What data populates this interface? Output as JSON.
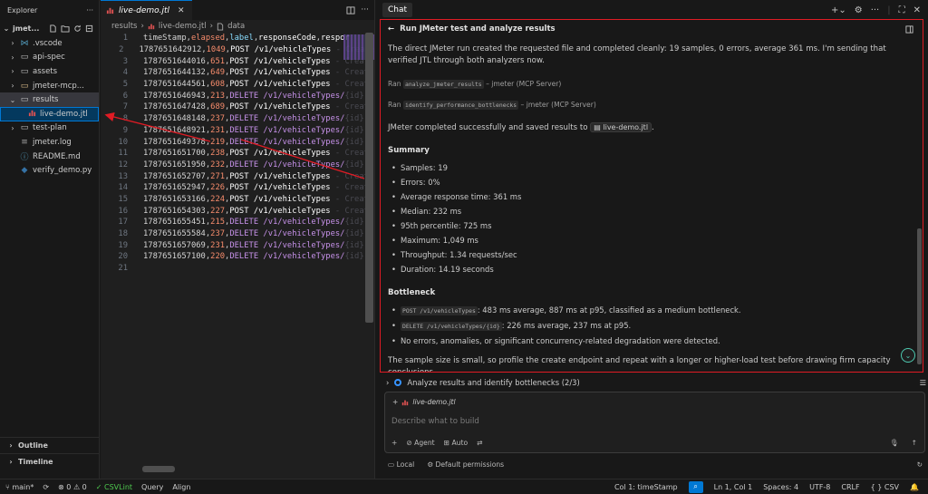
{
  "explorer": {
    "title": "Explorer",
    "project": "jmet...",
    "items": [
      {
        "label": ".vscode",
        "type": "folder",
        "indent": 1,
        "chev": "›",
        "color": "#519aba",
        "icon": "vscode-folder-icon"
      },
      {
        "label": "api-spec",
        "type": "folder",
        "indent": 1,
        "chev": "›",
        "color": "#c5c5c5",
        "icon": "folder-icon"
      },
      {
        "label": "assets",
        "type": "folder",
        "indent": 1,
        "chev": "›",
        "color": "#c5c5c5",
        "icon": "folder-icon"
      },
      {
        "label": "jmeter-mcp...",
        "type": "folder",
        "indent": 1,
        "chev": "›",
        "color": "#e2c08d",
        "icon": "folder-icon"
      },
      {
        "label": "results",
        "type": "folder-open",
        "indent": 1,
        "chev": "⌄",
        "color": "#c5c5c5",
        "icon": "folder-open-icon",
        "state": "selected"
      },
      {
        "label": "live-demo.jtl",
        "type": "file",
        "indent": 2,
        "chev": "",
        "color": "#e05252",
        "icon": "chart-file-icon",
        "state": "active"
      },
      {
        "label": "test-plan",
        "type": "folder",
        "indent": 1,
        "chev": "›",
        "color": "#c5c5c5",
        "icon": "folder-icon"
      },
      {
        "label": "jmeter.log",
        "type": "file",
        "indent": 1,
        "chev": "",
        "color": "#a0a0a0",
        "icon": "log-file-icon"
      },
      {
        "label": "README.md",
        "type": "file",
        "indent": 1,
        "chev": "",
        "color": "#519aba",
        "icon": "markdown-file-icon"
      },
      {
        "label": "verify_demo.py",
        "type": "file",
        "indent": 1,
        "chev": "",
        "color": "#3572a5",
        "icon": "python-file-icon"
      }
    ],
    "outline_label": "Outline",
    "timeline_label": "Timeline"
  },
  "editor": {
    "tab_label": "live-demo.jtl",
    "breadcrumb": [
      "results",
      "live-demo.jtl",
      "data"
    ],
    "header": {
      "c1": "timeStamp",
      "c2": "elapsed",
      "c3": "label",
      "c4": "responseCode",
      "c5": "respor"
    },
    "rows": [
      {
        "ts": "1787651642912",
        "el": "1049",
        "lb": "POST /v1/vehicleTypes",
        "rest": " - Create"
      },
      {
        "ts": "1787651644016",
        "el": "651",
        "lb": "POST /v1/vehicleTypes",
        "rest": " - Create"
      },
      {
        "ts": "1787651644132",
        "el": "649",
        "lb": "POST /v1/vehicleTypes",
        "rest": " - Create"
      },
      {
        "ts": "1787651644561",
        "el": "608",
        "lb": "POST /v1/vehicleTypes",
        "rest": " - Create"
      },
      {
        "ts": "1787651646943",
        "el": "213",
        "lb": "DELETE /v1/vehicleTypes/",
        "rest": "{id}"
      },
      {
        "ts": "1787651647428",
        "el": "689",
        "lb": "POST /v1/vehicleTypes",
        "rest": " - Create"
      },
      {
        "ts": "1787651648148",
        "el": "237",
        "lb": "DELETE /v1/vehicleTypes/",
        "rest": "{id}"
      },
      {
        "ts": "1787651648921",
        "el": "231",
        "lb": "DELETE /v1/vehicleTypes/",
        "rest": "{id}"
      },
      {
        "ts": "1787651649378",
        "el": "219",
        "lb": "DELETE /v1/vehicleTypes/",
        "rest": "{id}"
      },
      {
        "ts": "1787651651700",
        "el": "238",
        "lb": "POST /v1/vehicleTypes",
        "rest": " - Create"
      },
      {
        "ts": "1787651651950",
        "el": "232",
        "lb": "DELETE /v1/vehicleTypes/",
        "rest": "{id}"
      },
      {
        "ts": "1787651652707",
        "el": "271",
        "lb": "POST /v1/vehicleTypes",
        "rest": " - Create"
      },
      {
        "ts": "1787651652947",
        "el": "226",
        "lb": "POST /v1/vehicleTypes",
        "rest": " - Create"
      },
      {
        "ts": "1787651653166",
        "el": "224",
        "lb": "POST /v1/vehicleTypes",
        "rest": " - Create"
      },
      {
        "ts": "1787651654303",
        "el": "227",
        "lb": "POST /v1/vehicleTypes",
        "rest": " - Create"
      },
      {
        "ts": "1787651655451",
        "el": "215",
        "lb": "DELETE /v1/vehicleTypes/",
        "rest": "{id}"
      },
      {
        "ts": "1787651655584",
        "el": "237",
        "lb": "DELETE /v1/vehicleTypes/",
        "rest": "{id}"
      },
      {
        "ts": "1787651657069",
        "el": "231",
        "lb": "DELETE /v1/vehicleTypes/",
        "rest": "{id}"
      },
      {
        "ts": "1787651657100",
        "el": "220",
        "lb": "DELETE /v1/vehicleTypes/",
        "rest": "{id}"
      }
    ],
    "last_line_number": "21"
  },
  "chat": {
    "tab_label": "Chat",
    "response_title": "Run JMeter test and analyze results",
    "intro": "The direct JMeter run created the requested file and completed cleanly: 19 samples, 0 errors, average 361 ms. I'm sending that verified JTL through both analyzers now.",
    "ran1": {
      "prefix": "Ran",
      "tool": "analyze_jmeter_results",
      "suffix": "– jmeter (MCP Server)"
    },
    "ran2": {
      "prefix": "Ran",
      "tool": "identify_performance_bottlenecks",
      "suffix": "– jmeter (MCP Server)"
    },
    "completed": {
      "before": "JMeter completed successfully and saved results to",
      "file": "live-demo.jtl",
      "after": "."
    },
    "summary_heading": "Summary",
    "summary": [
      "Samples: 19",
      "Errors: 0%",
      "Average response time: 361 ms",
      "Median: 232 ms",
      "95th percentile: 725 ms",
      "Maximum: 1,049 ms",
      "Throughput: 1.34 requests/sec",
      "Duration: 14.19 seconds"
    ],
    "bottleneck_heading": "Bottleneck",
    "bottleneck_1": {
      "code": "POST /v1/vehicleTypes",
      "text": ": 483 ms average, 887 ms at p95, classified as a medium bottleneck."
    },
    "bottleneck_2": {
      "code": "DELETE /v1/vehicleTypes/{id}",
      "text": ": 226 ms average, 237 ms at p95."
    },
    "bottleneck_3": "No errors, anomalies, or significant concurrency-related degradation were detected.",
    "closing": "The sample size is small, so profile the create endpoint and repeat with a longer or higher-load test before drawing firm capacity conclusions.",
    "todo_label": "Analyze results and identify bottlenecks (2/3)",
    "attachment": "live-demo.jtl",
    "input_placeholder": "Describe what to build",
    "agent_label": "Agent",
    "auto_label": "Auto",
    "local_label": "Local",
    "permissions_label": "Default permissions"
  },
  "statusbar": {
    "branch": "main*",
    "errors": "0",
    "warnings": "0",
    "csvlint": "CSVLint",
    "query": "Query",
    "align": "Align",
    "column": "Col 1: timeStamp",
    "position": "Ln 1, Col 1",
    "spaces": "Spaces: 4",
    "encoding": "UTF-8",
    "eol": "CRLF",
    "language": "CSV"
  }
}
